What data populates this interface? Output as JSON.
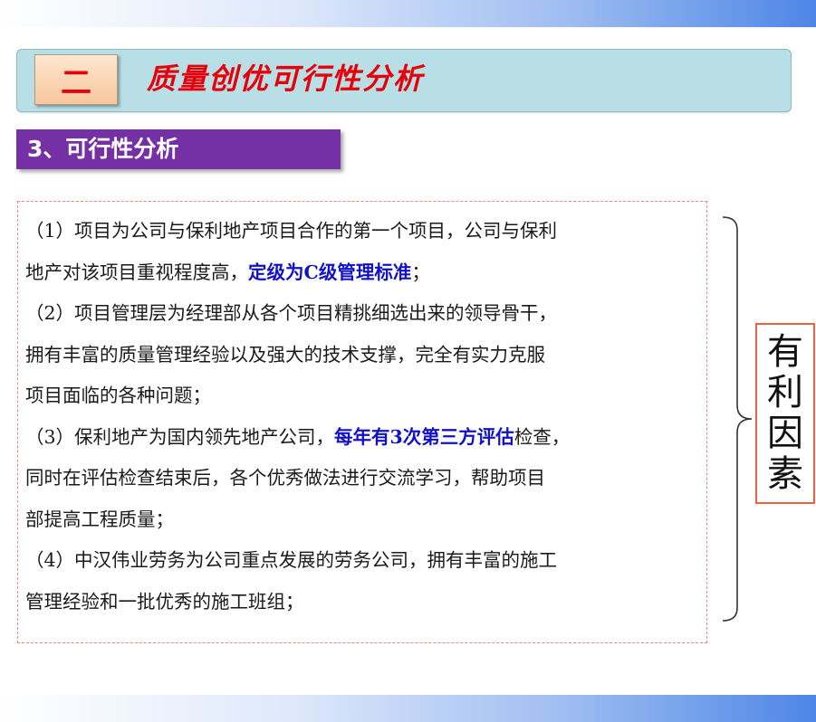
{
  "header": {
    "number": "二",
    "title": "质量创优可行性分析"
  },
  "section": {
    "title": "3、可行性分析"
  },
  "content": {
    "lines": [
      [
        {
          "t": "（1）项目为公司与保利地产项目合作的第一个项目，公司与保利"
        }
      ],
      [
        {
          "t": "地产对该项目重视程度高，"
        },
        {
          "t": "定级为C级管理标准",
          "hl": true
        },
        {
          "t": "；"
        }
      ],
      [
        {
          "t": "（2）项目管理层为经理部从各个项目精挑细选出来的领导骨干，"
        }
      ],
      [
        {
          "t": "拥有丰富的质量管理经验以及强大的技术支撑，完全有实力克服"
        }
      ],
      [
        {
          "t": "项目面临的各种问题；"
        }
      ],
      [
        {
          "t": "（3）保利地产为国内领先地产公司，"
        },
        {
          "t": "每年有3次第三方评估",
          "hl": true
        },
        {
          "t": "检查，"
        }
      ],
      [
        {
          "t": "同时在评估检查结束后，各个优秀做法进行交流学习，帮助项目"
        }
      ],
      [
        {
          "t": "部提高工程质量；"
        }
      ],
      [
        {
          "t": "（4）中汉伟业劳务为公司重点发展的劳务公司，拥有丰富的施工"
        }
      ],
      [
        {
          "t": "管理经验和一批优秀的施工班组；"
        }
      ]
    ]
  },
  "side_label": {
    "chars": [
      "有",
      "利",
      "因",
      "素"
    ]
  },
  "colors": {
    "title_red": "#e6000a",
    "highlight_blue": "#1111c9",
    "section_purple": "#7630a6",
    "title_bar_teal": "#b8dfe6",
    "factor_border": "#e8643c"
  }
}
